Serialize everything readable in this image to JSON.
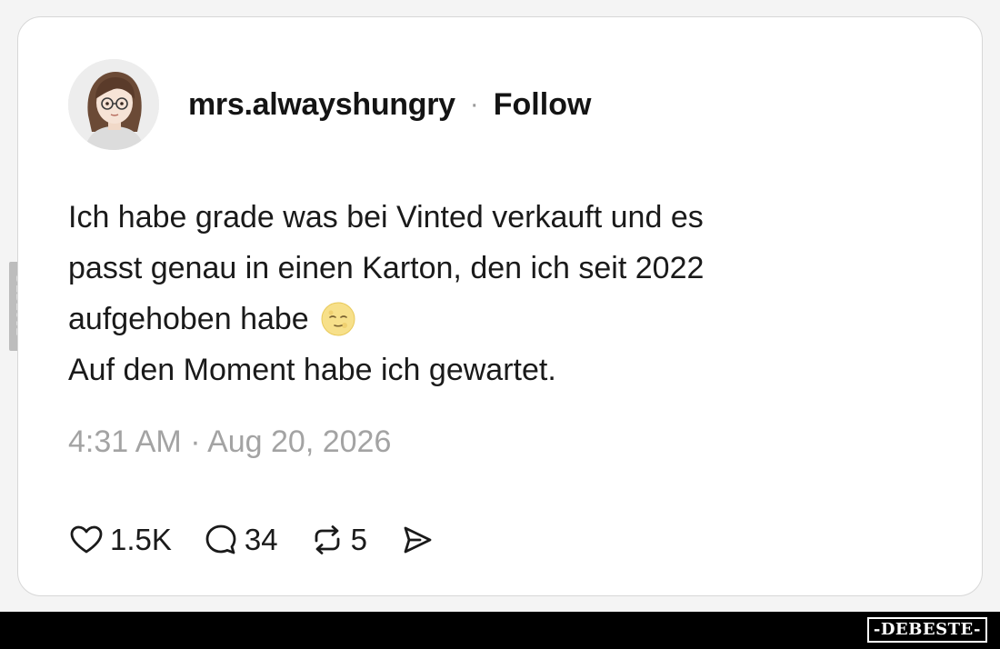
{
  "post": {
    "username": "mrs.alwayshungry",
    "separator": "·",
    "follow_label": "Follow",
    "text_lines": [
      "Ich habe grade was bei Vinted verkauft und es",
      "passt genau in einen Karton, den ich seit 2022",
      "aufgehoben habe",
      "Auf den Moment habe ich gewartet."
    ],
    "emoji_icon": "moon-face-icon",
    "timestamp": "4:31 AM · Aug 20, 2026"
  },
  "actions": {
    "likes": {
      "icon": "heart-icon",
      "count": "1.5K"
    },
    "comments": {
      "icon": "comment-icon",
      "count": "34"
    },
    "reposts": {
      "icon": "repost-icon",
      "count": "5"
    },
    "share": {
      "icon": "share-icon"
    }
  },
  "watermark": {
    "side_text": "DEBESTE",
    "footer_brand": "-DEBESTE-"
  },
  "colors": {
    "text": "#1a1a1a",
    "muted": "#a3a3a3",
    "card_border": "#d7d7d7",
    "footer": "#000000"
  }
}
